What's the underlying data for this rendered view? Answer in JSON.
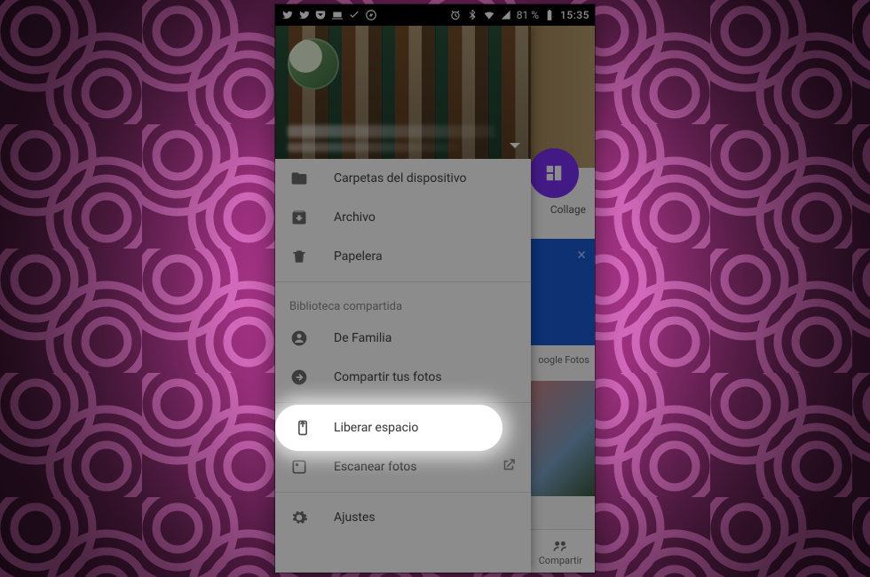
{
  "statusbar": {
    "battery_pct": "81 %",
    "clock": "15:35"
  },
  "drawer": {
    "items": [
      {
        "icon": "folder-icon",
        "label": "Carpetas del dispositivo"
      },
      {
        "icon": "archive-icon",
        "label": "Archivo"
      },
      {
        "icon": "trash-icon",
        "label": "Papelera"
      }
    ],
    "shared_section_label": "Biblioteca compartida",
    "shared_items": [
      {
        "icon": "person-icon",
        "label": "De Familia"
      },
      {
        "icon": "share-icon",
        "label": "Compartir tus fotos"
      }
    ],
    "utility_items": [
      {
        "icon": "free-space-icon",
        "label": "Liberar espacio"
      },
      {
        "icon": "scan-icon",
        "label": "Escanear fotos",
        "external": true
      },
      {
        "icon": "gear-icon",
        "label": "Ajustes"
      }
    ]
  },
  "behind": {
    "collage_label": "Collage",
    "google_photos_label": "oogle Fotos",
    "bottom_share_label": "Compartir"
  },
  "highlight_index": 0
}
